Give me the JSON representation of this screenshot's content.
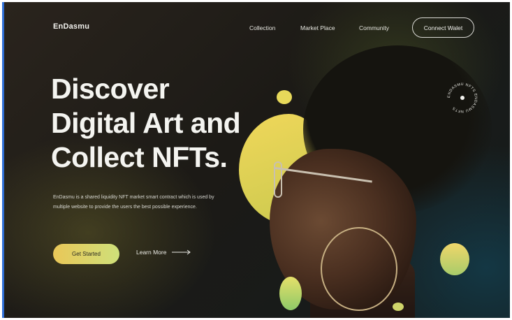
{
  "brand": {
    "name": "EnDasmu"
  },
  "nav": {
    "items": [
      {
        "label": "Collection"
      },
      {
        "label": "Market Place"
      },
      {
        "label": "Community"
      }
    ],
    "connect_label": "Connect Walet"
  },
  "hero": {
    "headline_lines": [
      "Discover",
      "Digital Art and",
      "Collect NFTs."
    ],
    "description": "EnDasmu is a shared liquidity NFT market smart contract which is used by multiple website to provide the users the best possible experience.",
    "primary_cta": "Get Started",
    "secondary_cta": "Learn More"
  },
  "badge": {
    "text": "ENDASMU NFTS ENDASMU NFTS"
  },
  "colors": {
    "accent_yellow": "#e9c758",
    "accent_green": "#cfe07a",
    "background": "#1c1a16"
  },
  "icons": {
    "learn_more": "arrow-right-icon"
  }
}
